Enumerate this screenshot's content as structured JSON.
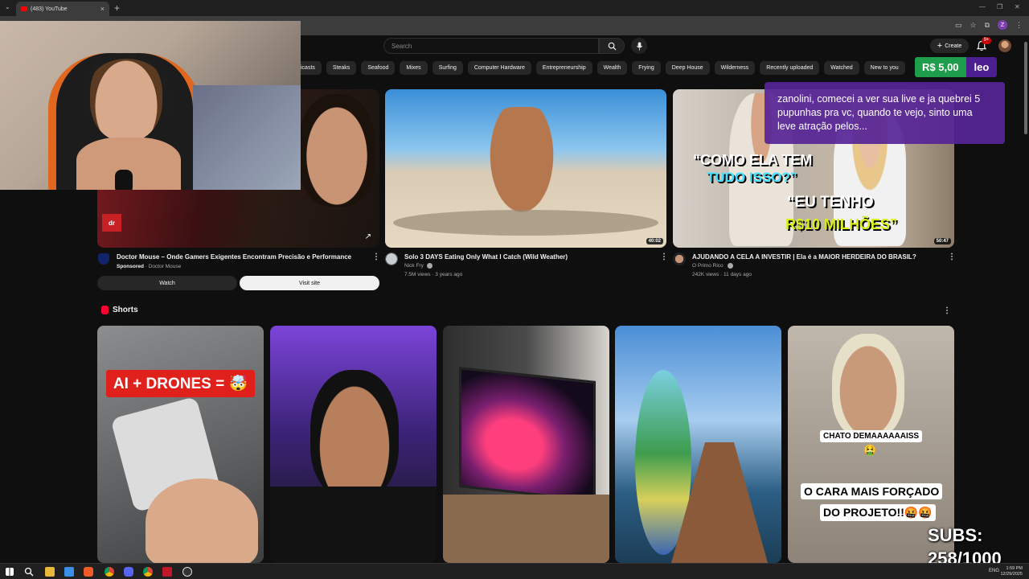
{
  "browser": {
    "tab_title": "(483) YouTube",
    "tab_close": "×",
    "new_tab": "+",
    "tab_menu": "⌄",
    "window_controls": [
      "—",
      "❐",
      "✕"
    ],
    "profile_letter": "Z"
  },
  "youtube": {
    "search_placeholder": "Search",
    "create_label": "Create",
    "notification_count": "9+",
    "chips": [
      "icasts",
      "Steaks",
      "Seafood",
      "Mixes",
      "Surfing",
      "Computer Hardware",
      "Entrepreneurship",
      "Wealth",
      "Frying",
      "Deep House",
      "Wilderness",
      "Recently uploaded",
      "Watched",
      "New to you"
    ],
    "videos": [
      {
        "title": "Doctor Mouse – Onde Gamers Exigentes Encontram Precisão e Performance",
        "sponsored": "Sponsored",
        "channel": "· Doctor Mouse",
        "thumb_tag": "dr",
        "watch_label": "Watch",
        "visit_label": "Visit site",
        "link_icon": "↗"
      },
      {
        "title": "Solo 3 DAYS Eating Only What I Catch (Wild Weather)",
        "channel": "Nick Fry",
        "meta": "7.5M views · 3 years ago",
        "duration": "40:02"
      },
      {
        "title": "AJUDANDO A CELA A INVESTIR | Ela é a MAIOR HERDEIRA DO BRASIL?",
        "channel": "O Primo Rico",
        "meta": "242K views · 11 days ago",
        "duration": "50:47",
        "thumb_text_1": "“COMO ELA TEM",
        "thumb_text_2": "TUDO ISSO?”",
        "thumb_text_3": "“EU TENHO",
        "thumb_text_4": "R$10 MILHÕES”"
      }
    ],
    "shorts_heading": "Shorts",
    "shorts": [
      {
        "overlay": "AI + DRONES = 🤯"
      },
      {
        "overlay": ""
      },
      {
        "overlay": ""
      },
      {
        "overlay": ""
      },
      {
        "overlay_1": "CHATO DEMAAAAAAISS",
        "overlay_2": "🤮",
        "overlay_3": "O CARA MAIS FORÇADO",
        "overlay_4": "DO PROJETO!!🤬🤬"
      }
    ]
  },
  "stream": {
    "donation_amount": "R$ 5,00",
    "donation_name": "leo",
    "donation_message": "zanolini, comecei a ver sua live e ja quebrei 5 pupunhas pra vc, quando te vejo, sinto uma leve atração pelos...",
    "subs_label": "SUBS:",
    "subs_count": "258/1000"
  },
  "taskbar": {
    "lang": "ENG",
    "time": "1:59 PM",
    "date": "12/29/2025"
  },
  "colors": {
    "background": "#0f0f0f",
    "donation_green": "#1e9e4c",
    "donation_purple": "#4b1f8f",
    "youtube_red": "#ff0000"
  }
}
